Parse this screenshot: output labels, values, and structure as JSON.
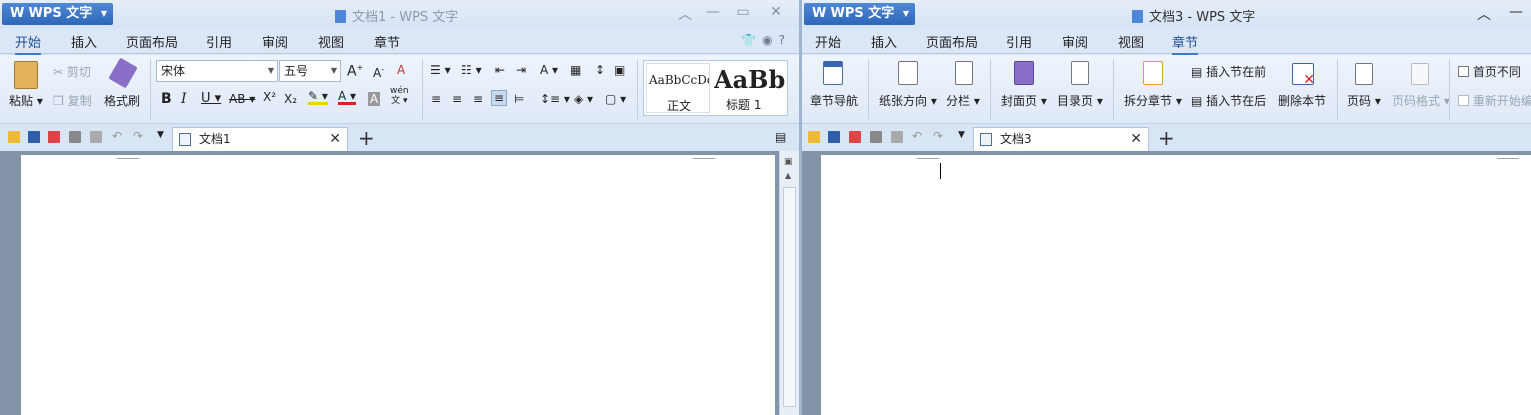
{
  "left": {
    "app_button": "WPS 文字",
    "window_title": "文档1 - WPS 文字",
    "ribbon_tabs": [
      "开始",
      "插入",
      "页面布局",
      "引用",
      "审阅",
      "视图",
      "章节"
    ],
    "active_tab": "开始",
    "clipboard": {
      "paste": "粘贴",
      "cut": "剪切",
      "copy": "复制",
      "format_painter": "格式刷"
    },
    "font_name": "宋体",
    "font_size": "五号",
    "styles": {
      "normal_preview": "AaBbCcDd",
      "normal": "正文",
      "heading_preview": "AaBb",
      "heading1": "标题 1"
    },
    "phonetic_top": "wén",
    "phonetic_bottom": "文",
    "doc_tab": "文档1"
  },
  "right": {
    "app_button": "WPS 文字",
    "window_title": "文档3 - WPS 文字",
    "ribbon_tabs": [
      "开始",
      "插入",
      "页面布局",
      "引用",
      "审阅",
      "视图",
      "章节"
    ],
    "active_tab": "章节",
    "chapter": {
      "nav": "章节导航",
      "orientation": "纸张方向",
      "columns": "分栏",
      "cover": "封面页",
      "toc": "目录页",
      "split": "拆分章节",
      "insert_before": "插入节在前",
      "insert_after": "插入节在后",
      "delete": "删除本节",
      "page_number": "页码",
      "page_number_format": "页码格式",
      "first_page_diff": "首页不同",
      "restart": "重新开始编"
    },
    "doc_tab": "文档3"
  }
}
